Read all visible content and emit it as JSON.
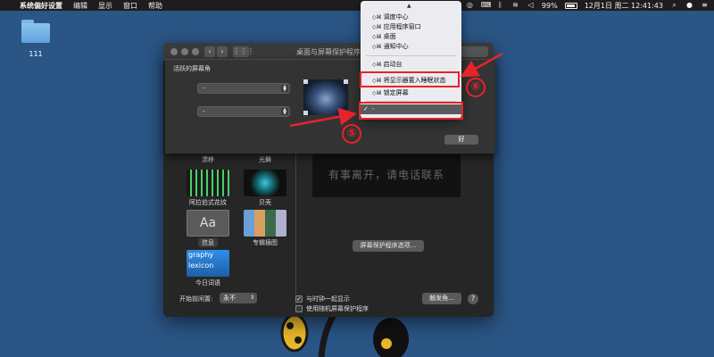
{
  "menubar": {
    "apple": "",
    "app_name": "系统偏好设置",
    "items": [
      "编辑",
      "显示",
      "窗口",
      "帮助"
    ],
    "battery": "99%",
    "clock": "12月1日 周二 12:41:43"
  },
  "desktop": {
    "folder_label": "111"
  },
  "window": {
    "title": "桌面与屏幕保护程序",
    "back": "‹",
    "forward": "›",
    "grid": "⋮⋮⋮"
  },
  "savers": [
    {
      "name": "漂移",
      "color1": "#3a6bd0",
      "color2": "#0c1a3a"
    },
    {
      "name": "光舞",
      "color1": "#2f2f3f",
      "color2": "#111"
    },
    {
      "name": "阿拉伯式花纹",
      "color1": "#3fd06a",
      "color2": "#185f2f"
    },
    {
      "name": "贝壳",
      "color1": "#1c7f8f",
      "color2": "#101010"
    },
    {
      "name": "信息",
      "thumb_text": "Aa",
      "selected": true
    },
    {
      "name": "专辑插图",
      "color1": "#6a9fd8",
      "color2": "#2a4060"
    },
    {
      "name": "今日词语",
      "thumb_text": "graphy lexicon",
      "color1": "#2f8fe8",
      "color2": "#1e5fa6"
    }
  ],
  "preview": {
    "message": "有事离开，请电话联系"
  },
  "buttons": {
    "saver_options": "屏幕保护程序选项...",
    "hot_corners": "触发角...",
    "help": "?",
    "ok": "好"
  },
  "bottom": {
    "start_label": "开始前闲置:",
    "start_value": "永不",
    "show_clock": "与时钟一起显示",
    "show_clock_checked": true,
    "random_saver": "使用随机屏幕保护程序",
    "random_saver_checked": false
  },
  "sheet": {
    "title": "活跃的屏幕角",
    "top_left": "-",
    "bottom_left": "-"
  },
  "menu": {
    "mods": "◇⌘",
    "items": [
      {
        "label": "调度中心"
      },
      {
        "label": "应用程序窗口"
      },
      {
        "label": "桌面"
      },
      {
        "label": "通知中心"
      },
      {
        "label": "启动台"
      },
      {
        "label": "将显示器置入睡眠状态"
      },
      {
        "label": "锁定屏幕"
      }
    ],
    "selected": "-",
    "check": "✓"
  },
  "annotations": {
    "step5": "⑤",
    "step6": "⑥"
  },
  "colors": {
    "annotation_red": "#e8232a",
    "desktop_blue": "#2a5585"
  }
}
